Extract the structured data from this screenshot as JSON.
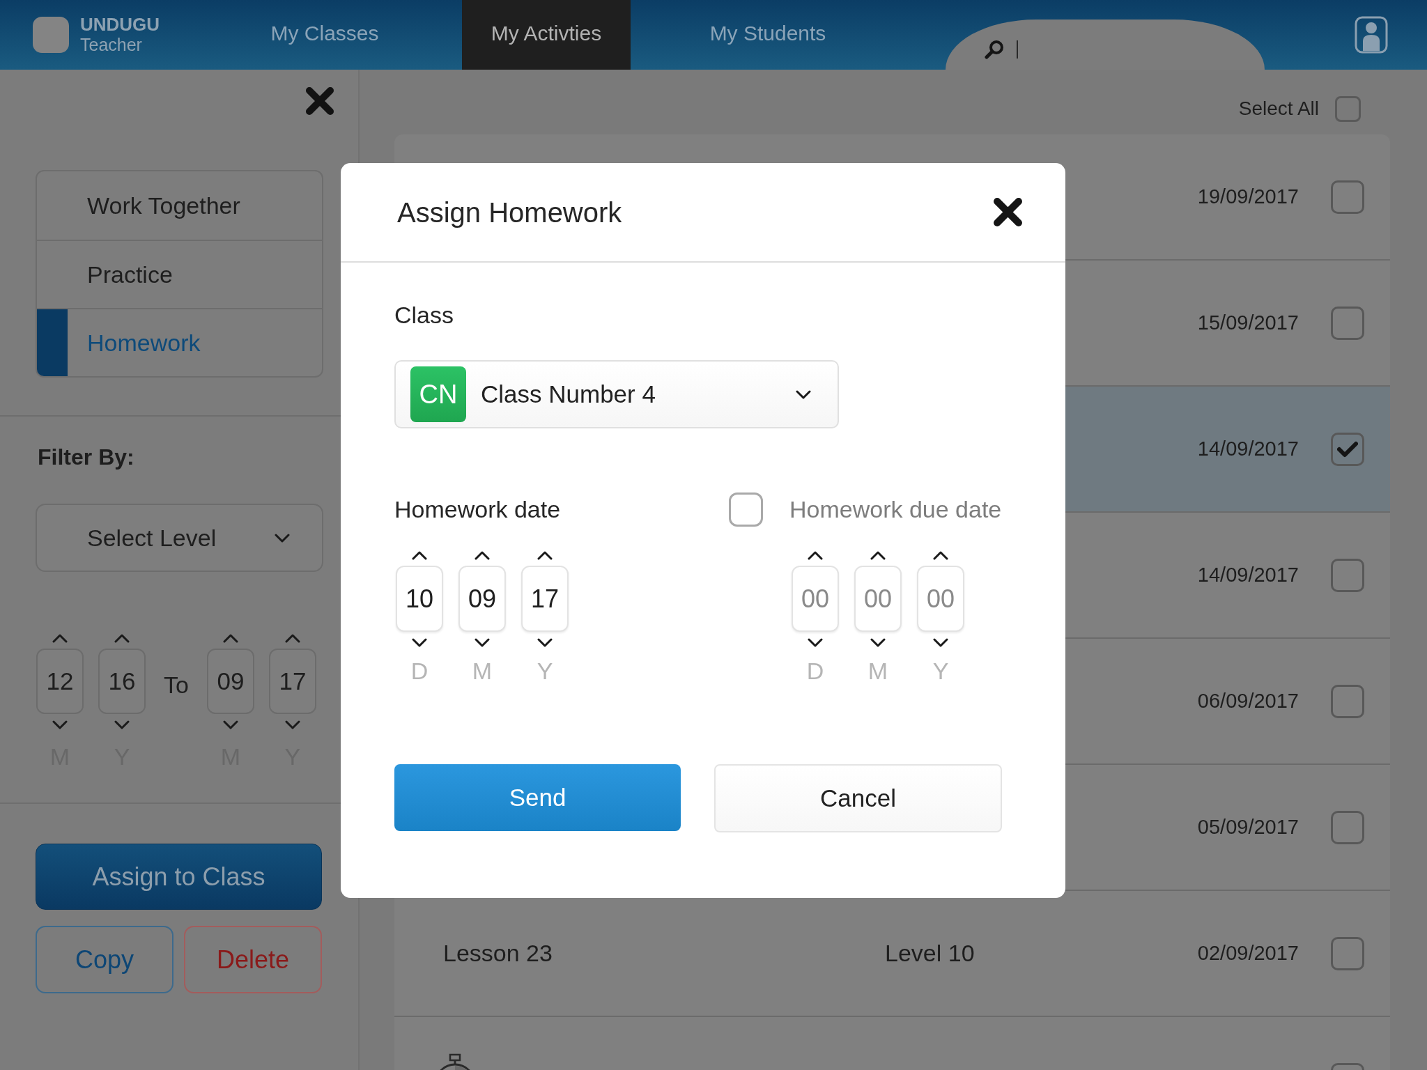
{
  "app": {
    "brand": "UNDUGU",
    "role": "Teacher"
  },
  "nav_tabs": [
    {
      "label": "My Classes",
      "selected": false
    },
    {
      "label": "My Activties",
      "selected": true
    },
    {
      "label": "My Students",
      "selected": false
    }
  ],
  "sidebar": {
    "activity_types": [
      {
        "label": "Work Together",
        "selected": false
      },
      {
        "label": "Practice",
        "selected": false
      },
      {
        "label": "Homework",
        "selected": true
      }
    ],
    "filter_label": "Filter By:",
    "level_select": {
      "value": "Select Level"
    },
    "date_range": {
      "from": [
        {
          "value": "12",
          "unit": "M"
        },
        {
          "value": "16",
          "unit": "Y"
        }
      ],
      "separator": "To",
      "to": [
        {
          "value": "09",
          "unit": "M"
        },
        {
          "value": "17",
          "unit": "Y"
        }
      ]
    },
    "buttons": [
      {
        "label": "Assign to Class",
        "kind": "primary"
      },
      {
        "label": "Copy",
        "kind": "outline"
      },
      {
        "label": "Delete",
        "kind": "danger"
      }
    ]
  },
  "list": {
    "select_all": {
      "label": "Select All",
      "checked": false
    },
    "rows": [
      {
        "kind": "lesson",
        "date": "19/09/2017",
        "selected": false
      },
      {
        "kind": "lesson",
        "date": "15/09/2017",
        "selected": false
      },
      {
        "kind": "lesson",
        "date": "14/09/2017",
        "selected": true
      },
      {
        "kind": "lesson",
        "date": "14/09/2017",
        "selected": false
      },
      {
        "kind": "lesson",
        "date": "06/09/2017",
        "selected": false
      },
      {
        "kind": "lesson",
        "date": "05/09/2017",
        "selected": false
      },
      {
        "kind": "lesson",
        "lesson": "Lesson 23",
        "level": "Level 10",
        "date": "02/09/2017",
        "selected": false
      },
      {
        "kind": "timer",
        "selected": false
      }
    ]
  },
  "dialog": {
    "title": "Assign Homework",
    "class_label": "Class",
    "class_select": {
      "badge": "CN",
      "value": "Class Number 4"
    },
    "homework_date": {
      "label": "Homework date",
      "fields": [
        {
          "value": "10",
          "unit": "D"
        },
        {
          "value": "09",
          "unit": "M"
        },
        {
          "value": "17",
          "unit": "Y"
        }
      ]
    },
    "due_date": {
      "label": "Homework due date",
      "checked": false,
      "fields": [
        {
          "value": "00",
          "unit": "D"
        },
        {
          "value": "00",
          "unit": "M"
        },
        {
          "value": "00",
          "unit": "Y"
        }
      ]
    },
    "buttons": [
      {
        "label": "Send",
        "kind": "primary"
      },
      {
        "label": "Cancel",
        "kind": "secondary"
      }
    ]
  }
}
